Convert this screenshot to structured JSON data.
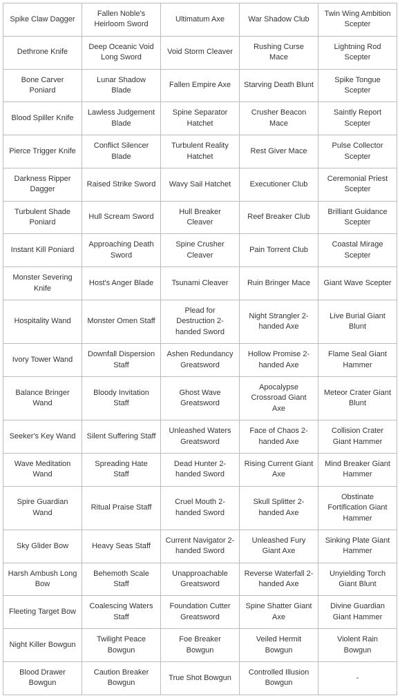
{
  "table": {
    "rows": [
      [
        "Spike Claw Dagger",
        "Fallen Noble's Heirloom Sword",
        "Ultimatum Axe",
        "War Shadow Club",
        "Twin Wing Ambition Scepter"
      ],
      [
        "Dethrone Knife",
        "Deep Oceanic Void Long Sword",
        "Void Storm Cleaver",
        "Rushing Curse Mace",
        "Lightning Rod Scepter"
      ],
      [
        "Bone Carver Poniard",
        "Lunar Shadow Blade",
        "Fallen Empire Axe",
        "Starving Death Blunt",
        "Spike Tongue Scepter"
      ],
      [
        "Blood Spiller Knife",
        "Lawless Judgement Blade",
        "Spine Separator Hatchet",
        "Crusher Beacon Mace",
        "Saintly Report Scepter"
      ],
      [
        "Pierce Trigger Knife",
        "Conflict Silencer Blade",
        "Turbulent Reality Hatchet",
        "Rest Giver Mace",
        "Pulse Collector Scepter"
      ],
      [
        "Darkness Ripper Dagger",
        "Raised Strike Sword",
        "Wavy Sail Hatchet",
        "Executioner Club",
        "Ceremonial Priest Scepter"
      ],
      [
        "Turbulent Shade Poniard",
        "Hull Scream Sword",
        "Hull Breaker Cleaver",
        "Reef Breaker Club",
        "Brilliant Guidance Scepter"
      ],
      [
        "Instant Kill Poniard",
        "Approaching Death Sword",
        "Spine Crusher Cleaver",
        "Pain Torrent Club",
        "Coastal Mirage Scepter"
      ],
      [
        "Monster Severing Knife",
        "Host's Anger Blade",
        "Tsunami Cleaver",
        "Ruin Bringer Mace",
        "Giant Wave Scepter"
      ],
      [
        "Hospitality Wand",
        "Monster Omen Staff",
        "Plead for Destruction 2-handed Sword",
        "Night Strangler 2-handed Axe",
        "Live Burial Giant Blunt"
      ],
      [
        "Ivory Tower Wand",
        "Downfall Dispersion Staff",
        "Ashen Redundancy Greatsword",
        "Hollow Promise 2-handed Axe",
        "Flame Seal Giant Hammer"
      ],
      [
        "Balance Bringer Wand",
        "Bloody Invitation Staff",
        "Ghost Wave Greatsword",
        "Apocalypse Crossroad Giant Axe",
        "Meteor Crater Giant Blunt"
      ],
      [
        "Seeker's Key Wand",
        "Silent Suffering Staff",
        "Unleashed Waters Greatsword",
        "Face of Chaos 2-handed Axe",
        "Collision Crater Giant Hammer"
      ],
      [
        "Wave Meditation Wand",
        "Spreading Hate Staff",
        "Dead Hunter 2-handed Sword",
        "Rising Current Giant Axe",
        "Mind Breaker Giant Hammer"
      ],
      [
        "Spire Guardian Wand",
        "Ritual Praise Staff",
        "Cruel Mouth 2-handed Sword",
        "Skull Splitter 2-handed Axe",
        "Obstinate Fortification Giant Hammer"
      ],
      [
        "Sky Glider Bow",
        "Heavy Seas Staff",
        "Current Navigator 2-handed Sword",
        "Unleashed Fury Giant Axe",
        "Sinking Plate Giant Hammer"
      ],
      [
        "Harsh Ambush Long Bow",
        "Behemoth Scale Staff",
        "Unapproachable Greatsword",
        "Reverse Waterfall 2-handed Axe",
        "Unyielding Torch Giant Blunt"
      ],
      [
        "Fleeting Target Bow",
        "Coalescing Waters Staff",
        "Foundation Cutter Greatsword",
        "Spine Shatter Giant Axe",
        "Divine Guardian Giant Hammer"
      ],
      [
        "Night Killer Bowgun",
        "Twilight Peace Bowgun",
        "Foe Breaker Bowgun",
        "Veiled Hermit Bowgun",
        "Violent Rain Bowgun"
      ],
      [
        "Blood Drawer Bowgun",
        "Caution Breaker Bowgun",
        "True Shot Bowgun",
        "Controlled Illusion Bowgun",
        "-"
      ]
    ]
  }
}
